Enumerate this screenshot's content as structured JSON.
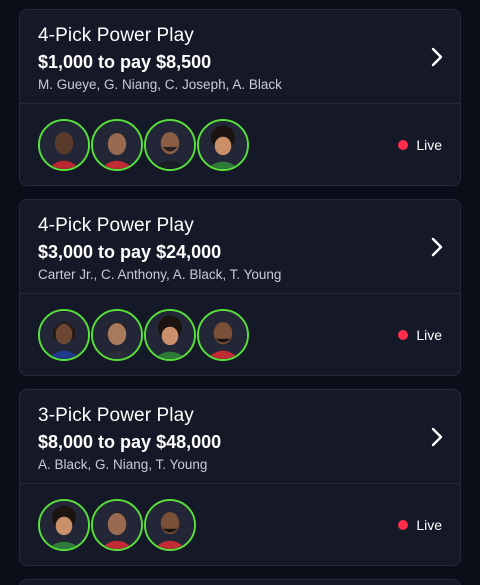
{
  "entries": [
    {
      "title": "4-Pick Power Play",
      "amount": "$1,000 to pay $8,500",
      "players": "M. Gueye, G. Niang, C. Joseph, A. Black",
      "status": "Live",
      "avatars": [
        "player-avatar-m-gueye",
        "player-avatar-g-niang",
        "player-avatar-c-joseph",
        "player-avatar-a-black"
      ]
    },
    {
      "title": "4-Pick Power Play",
      "amount": "$3,000 to pay $24,000",
      "players": "Carter Jr., C. Anthony, A. Black, T. Young",
      "status": "Live",
      "avatars": [
        "player-avatar-carter-jr",
        "player-avatar-c-anthony",
        "player-avatar-a-black",
        "player-avatar-t-young"
      ]
    },
    {
      "title": "3-Pick Power Play",
      "amount": "$8,000 to pay $48,000",
      "players": "A. Black, G. Niang, T. Young",
      "status": "Live",
      "avatars": [
        "player-avatar-a-black",
        "player-avatar-g-niang",
        "player-avatar-t-young"
      ]
    }
  ],
  "colors": {
    "background": "#0b0d18",
    "card": "#151826",
    "avatar_ring": "#57e03b",
    "live_dot": "#ff2d4b"
  },
  "icons": {
    "chevron": "chevron-right-icon",
    "live": "live-dot-icon"
  }
}
